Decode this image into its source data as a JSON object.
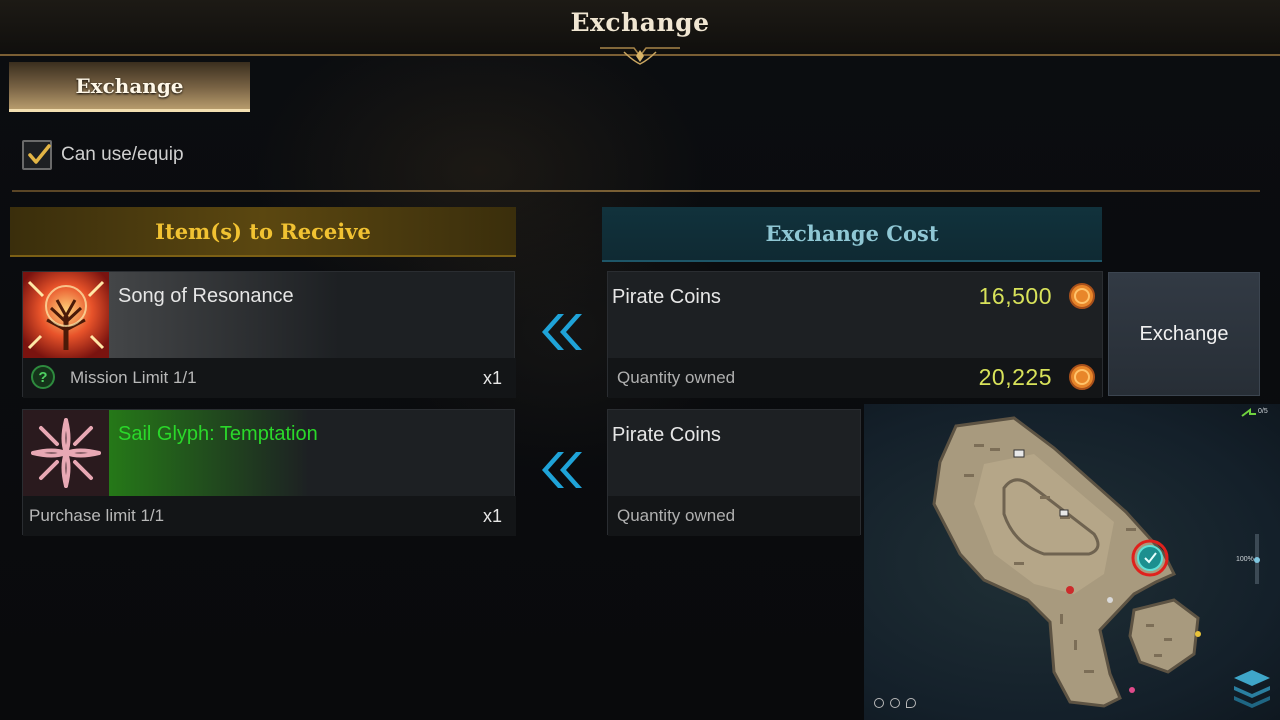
{
  "window": {
    "title": "Exchange"
  },
  "tabs": [
    {
      "label": "Exchange",
      "active": true
    }
  ],
  "filter": {
    "label": "Can use/equip",
    "checked": true
  },
  "headers": {
    "receive": "Item(s) to Receive",
    "cost": "Exchange Cost"
  },
  "items": [
    {
      "name": "Song of Resonance",
      "name_color": "#e6e6e6",
      "icon": "golden-tree-icon",
      "limit": "Mission Limit 1/1",
      "limit_has_help": true,
      "quantity": "x1"
    },
    {
      "name": "Sail Glyph: Temptation",
      "name_color": "#2ad82a",
      "icon": "sail-glyph-icon",
      "limit": "Purchase limit 1/1",
      "limit_has_help": false,
      "quantity": "x1"
    }
  ],
  "costs": [
    {
      "currency": "Pirate Coins",
      "required": "16,500",
      "owned_label": "Quantity owned",
      "owned": "20,225",
      "icon": "pirate-coin-icon"
    },
    {
      "currency": "Pirate Coins",
      "owned_label": "Quantity owned"
    }
  ],
  "actions": {
    "exchange": "Exchange"
  },
  "minimap": {
    "zoom": "100%",
    "counter": "0/5",
    "player_marker": "player-location-icon"
  },
  "colors": {
    "gold": "#f1c232",
    "teal": "#8fc7d4",
    "amount": "#d8e25a",
    "rare_green": "#2ad82a",
    "marker_red": "#e0211c"
  }
}
